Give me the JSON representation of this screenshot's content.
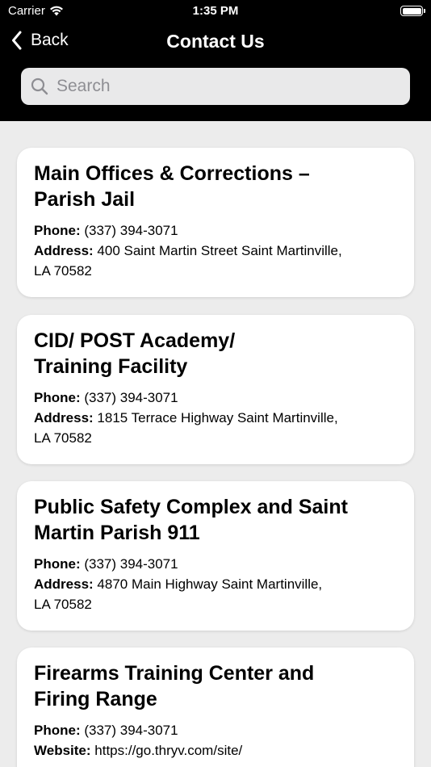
{
  "status_bar": {
    "carrier": "Carrier",
    "time": "1:35 PM"
  },
  "nav": {
    "back_label": "Back",
    "title": "Contact Us"
  },
  "search": {
    "placeholder": "Search"
  },
  "contacts": [
    {
      "title_line1": "Main Offices & Corrections –",
      "title_line2": "Parish Jail",
      "phone_label": "Phone:",
      "phone": " (337) 394-3071",
      "address_label": "Address:",
      "address_line1": " 400 Saint Martin Street  Saint Martinville,",
      "address_line2": "LA 70582"
    },
    {
      "title_line1": "CID/ POST Academy/",
      "title_line2": "Training Facility",
      "phone_label": "Phone:",
      "phone": " (337) 394-3071",
      "address_label": "Address:",
      "address_line1": " 1815 Terrace Highway  Saint Martinville,",
      "address_line2": "LA 70582"
    },
    {
      "title_line1": "Public Safety Complex and Saint",
      "title_line2": "Martin Parish 911",
      "phone_label": "Phone:",
      "phone": " (337) 394-3071",
      "address_label": "Address:",
      "address_line1": " 4870 Main Highway  Saint Martinville,",
      "address_line2": "LA 70582"
    },
    {
      "title_line1": "Firearms Training Center and",
      "title_line2": "Firing Range",
      "phone_label": "Phone:",
      "phone": " (337) 394-3071",
      "website_label": "Website:",
      "website": " https://go.thryv.com/site/"
    }
  ]
}
